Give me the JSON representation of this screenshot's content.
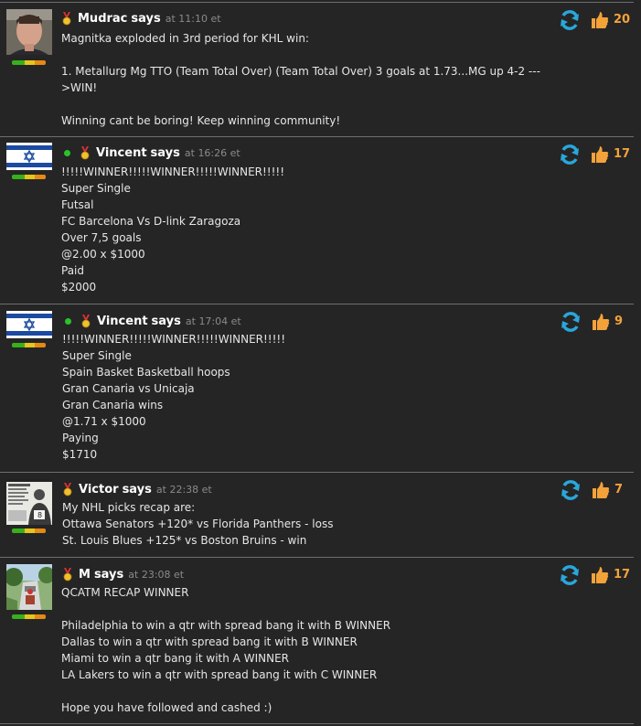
{
  "comments": [
    {
      "author": "Mudrac",
      "says": "says",
      "at": "at",
      "time": "11:10 et",
      "likes": "20",
      "online": false,
      "body": "Magnitka exploded in 3rd period for KHL win:\n\n1. Metallurg Mg TTO (Team Total Over) (Team Total Over) 3 goals at 1.73...MG up 4-2 ---\n>WIN!\n\nWinning cant be boring! Keep winning community!"
    },
    {
      "author": "Vincent",
      "says": "says",
      "at": "at",
      "time": "16:26 et",
      "likes": "17",
      "online": true,
      "body": "!!!!!WINNER!!!!!WINNER!!!!!WINNER!!!!!\nSuper Single\nFutsal\nFC Barcelona Vs D-link Zaragoza\nOver 7,5 goals\n@2.00 x $1000\nPaid\n$2000"
    },
    {
      "author": "Vincent",
      "says": "says",
      "at": "at",
      "time": "17:04 et",
      "likes": "9",
      "online": true,
      "body": "!!!!!WINNER!!!!!WINNER!!!!!WINNER!!!!!\nSuper Single\nSpain Basket Basketball hoops\nGran Canaria vs Unicaja\nGran Canaria wins\n@1.71 x $1000\nPaying\n$1710"
    },
    {
      "author": "Victor",
      "says": "says",
      "at": "at",
      "time": "22:38 et",
      "likes": "7",
      "online": false,
      "body": "My NHL picks recap are:\nOttawa Senators +120* vs Florida Panthers - loss\nSt. Louis Blues +125* vs Boston Bruins - win"
    },
    {
      "author": "M",
      "says": "says",
      "at": "at",
      "time": "23:08 et",
      "likes": "17",
      "online": false,
      "body": "QCATM RECAP WINNER\n\nPhiladelphia to win a qtr with spread bang it with B WINNER\nDallas to win a qtr with spread bang it with B WINNER\nMiami to win a qtr bang it with A WINNER\nLA Lakers to win a qtr with spread bang it with C WINNER\n\nHope you have followed and cashed :)"
    }
  ],
  "icons": {
    "reply": "refresh-arrows-icon",
    "like": "thumbs-up-icon",
    "medal": "medal-icon",
    "online": "online-status-dot"
  },
  "colors": {
    "background": "#252525",
    "like_count": "#f3a23a",
    "reply_icon": "#29a7db",
    "like_icon": "#f3a23a",
    "online": "#29c22b"
  }
}
